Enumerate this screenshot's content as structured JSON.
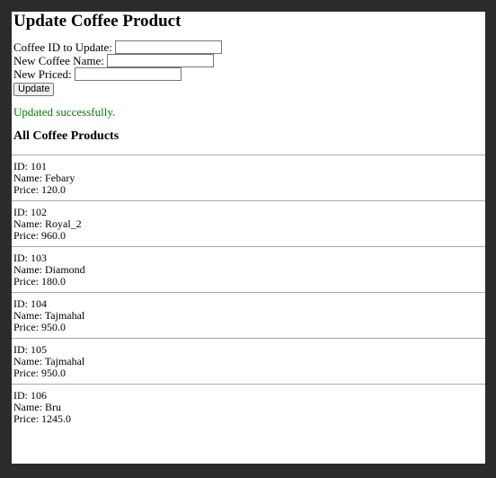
{
  "page": {
    "title": "Update Coffee Product"
  },
  "form": {
    "id_label": "Coffee ID to Update:",
    "id_value": "",
    "name_label": "New Coffee Name:",
    "name_value": "",
    "price_label": "New Priced:",
    "price_value": "",
    "submit_label": "Update"
  },
  "status": {
    "message": "Updated successfully.",
    "color": "#008000"
  },
  "products_section": {
    "title": "All Coffee Products",
    "id_prefix": "ID:",
    "name_prefix": "Name:",
    "price_prefix": "Price:",
    "items": [
      {
        "id": "101",
        "name": "Febary",
        "price": "120.0"
      },
      {
        "id": "102",
        "name": "Royal_2",
        "price": "960.0"
      },
      {
        "id": "103",
        "name": "Diamond",
        "price": "180.0"
      },
      {
        "id": "104",
        "name": "Tajmahal",
        "price": "950.0"
      },
      {
        "id": "105",
        "name": "Tajmahal",
        "price": "950.0"
      },
      {
        "id": "106",
        "name": "Bru",
        "price": "1245.0"
      }
    ]
  }
}
